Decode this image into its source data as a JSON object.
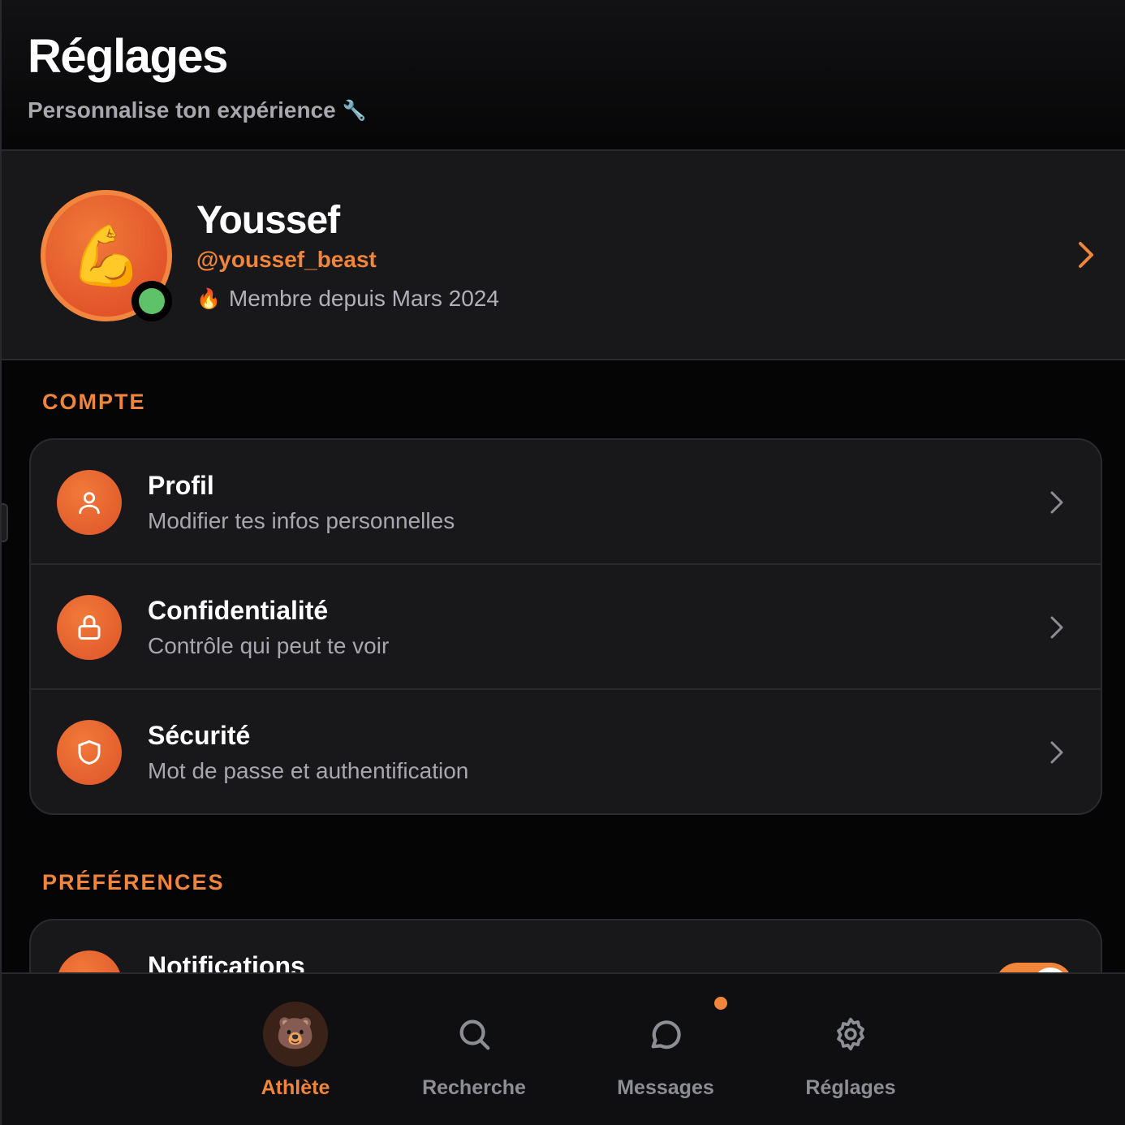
{
  "header": {
    "title": "Réglages",
    "subtitle": "Personnalise ton expérience",
    "subtitle_emoji": "🔧"
  },
  "profile": {
    "avatar_emoji": "💪",
    "name": "Youssef",
    "handle": "@youssef_beast",
    "member_emoji": "🔥",
    "member_since": "Membre depuis Mars 2024",
    "online": true
  },
  "sections": {
    "account": {
      "label": "COMPTE",
      "items": [
        {
          "title": "Profil",
          "desc": "Modifier tes infos personnelles",
          "icon": "user-icon"
        },
        {
          "title": "Confidentialité",
          "desc": "Contrôle qui peut te voir",
          "icon": "lock-icon"
        },
        {
          "title": "Sécurité",
          "desc": "Mot de passe et authentification",
          "icon": "shield-icon"
        }
      ]
    },
    "preferences": {
      "label": "PRÉFÉRENCES",
      "items": [
        {
          "title": "Notifications",
          "icon": "bell-icon",
          "toggle_on": true
        }
      ]
    }
  },
  "nav": {
    "items": [
      {
        "label": "Athlète",
        "icon": "bear-avatar-icon",
        "active": true
      },
      {
        "label": "Recherche",
        "icon": "search-icon",
        "active": false
      },
      {
        "label": "Messages",
        "icon": "message-icon",
        "active": false,
        "badge": true
      },
      {
        "label": "Réglages",
        "icon": "gear-icon",
        "active": false
      }
    ]
  },
  "colors": {
    "accent": "#f0853b",
    "online": "#5ec26a",
    "background": "#050506",
    "card": "#18181b"
  }
}
